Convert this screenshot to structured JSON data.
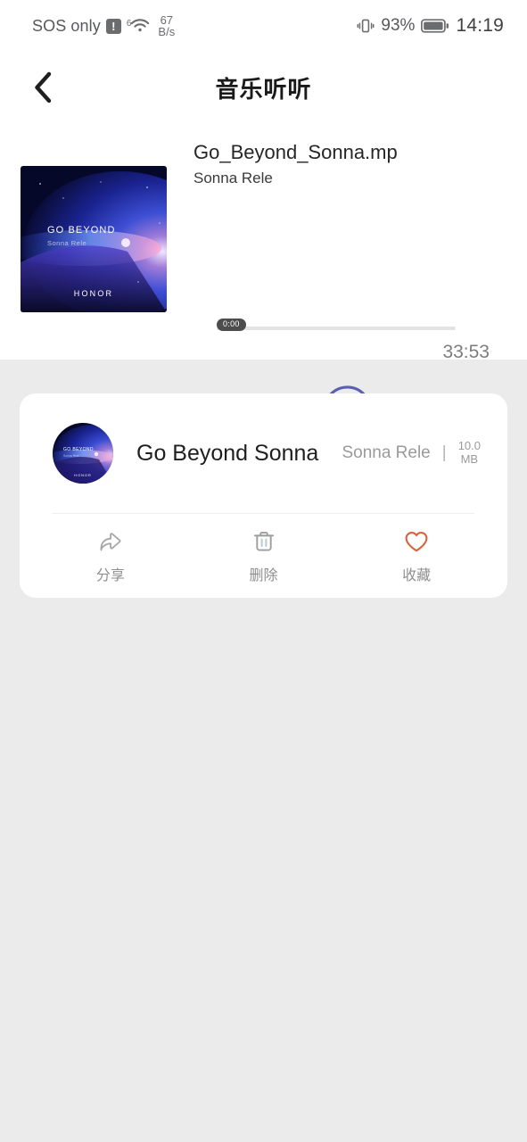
{
  "statusbar": {
    "carrier": "SOS only",
    "alert_icon": "!",
    "wifi_generation": "6",
    "wifi_icon": "wifi-icon",
    "netspeed_value": "67",
    "netspeed_unit": "B/s",
    "vibrate_icon": "vibrate-icon",
    "battery_percent": "93%",
    "battery_icon": "battery-icon",
    "clock": "14:19"
  },
  "navbar": {
    "back_icon": "chevron-left-icon",
    "title": "音乐听听"
  },
  "player": {
    "cover_alt": "album-cover",
    "cover_title": "GO BEYOND",
    "cover_subtitle": "Sonna Rele",
    "cover_brand": "HONOR",
    "track_title": "Go_Beyond_Sonna.mp",
    "track_artist": "Sonna Rele",
    "current_time": "0:00",
    "duration": "33:53",
    "play_icon": "play-circle-icon",
    "progress_percent": 0,
    "accent_color": "#5b5fb0"
  },
  "card": {
    "thumb_alt": "file-thumbnail",
    "file_title": "Go Beyond Sonna",
    "file_artist": "Sonna Rele",
    "separator": "|",
    "file_size": "10.0\nMB",
    "actions": [
      {
        "label": "分享",
        "icon": "share-icon",
        "color": "#9a9a9a"
      },
      {
        "label": "删除",
        "icon": "trash-icon",
        "color": "#9a9a9a"
      },
      {
        "label": "收藏",
        "icon": "heart-icon",
        "color": "#d9633f"
      }
    ]
  },
  "colors": {
    "page_background": "#ebebeb",
    "surface": "#ffffff",
    "accent": "#5b5fb0",
    "favorite": "#d9633f"
  }
}
